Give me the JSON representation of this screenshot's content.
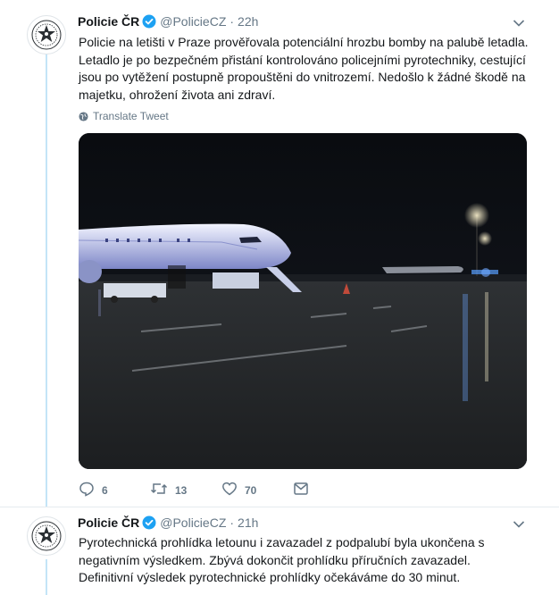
{
  "tweets": [
    {
      "author_name": "Policie ČR",
      "handle": "@PolicieCZ",
      "time": "22h",
      "text": "Policie na letišti v Praze prověřovala potenciální hrozbu bomby na palubě letadla. Letadlo je po bezpečném přistání kontrolováno policejními pyrotechniky, cestující jsou po vytěžení postupně propouštěni do vnitrozemí. Nedošlo k žádné škodě na majetku, ohrožení života ani zdraví.",
      "translate_label": "Translate Tweet",
      "replies": "6",
      "retweets": "13",
      "likes": "70"
    },
    {
      "author_name": "Policie ČR",
      "handle": "@PolicieCZ",
      "time": "21h",
      "text": "Pyrotechnická prohlídka letounu i zavazadel z podpalubí byla ukončena s negativním výsledkem. Zbývá dokončit prohlídku příručních zavazadel. Definitivní výsledek pyrotechnické prohlídky očekáváme do 30 minut."
    }
  ],
  "colors": {
    "verified": "#1da1f2",
    "muted": "#657786",
    "thread": "#c4e4f7"
  },
  "icons": [
    "police-star-logo",
    "verified-badge-icon",
    "chevron-down-icon",
    "globe-icon",
    "reply-icon",
    "retweet-icon",
    "like-icon",
    "share-icon"
  ]
}
